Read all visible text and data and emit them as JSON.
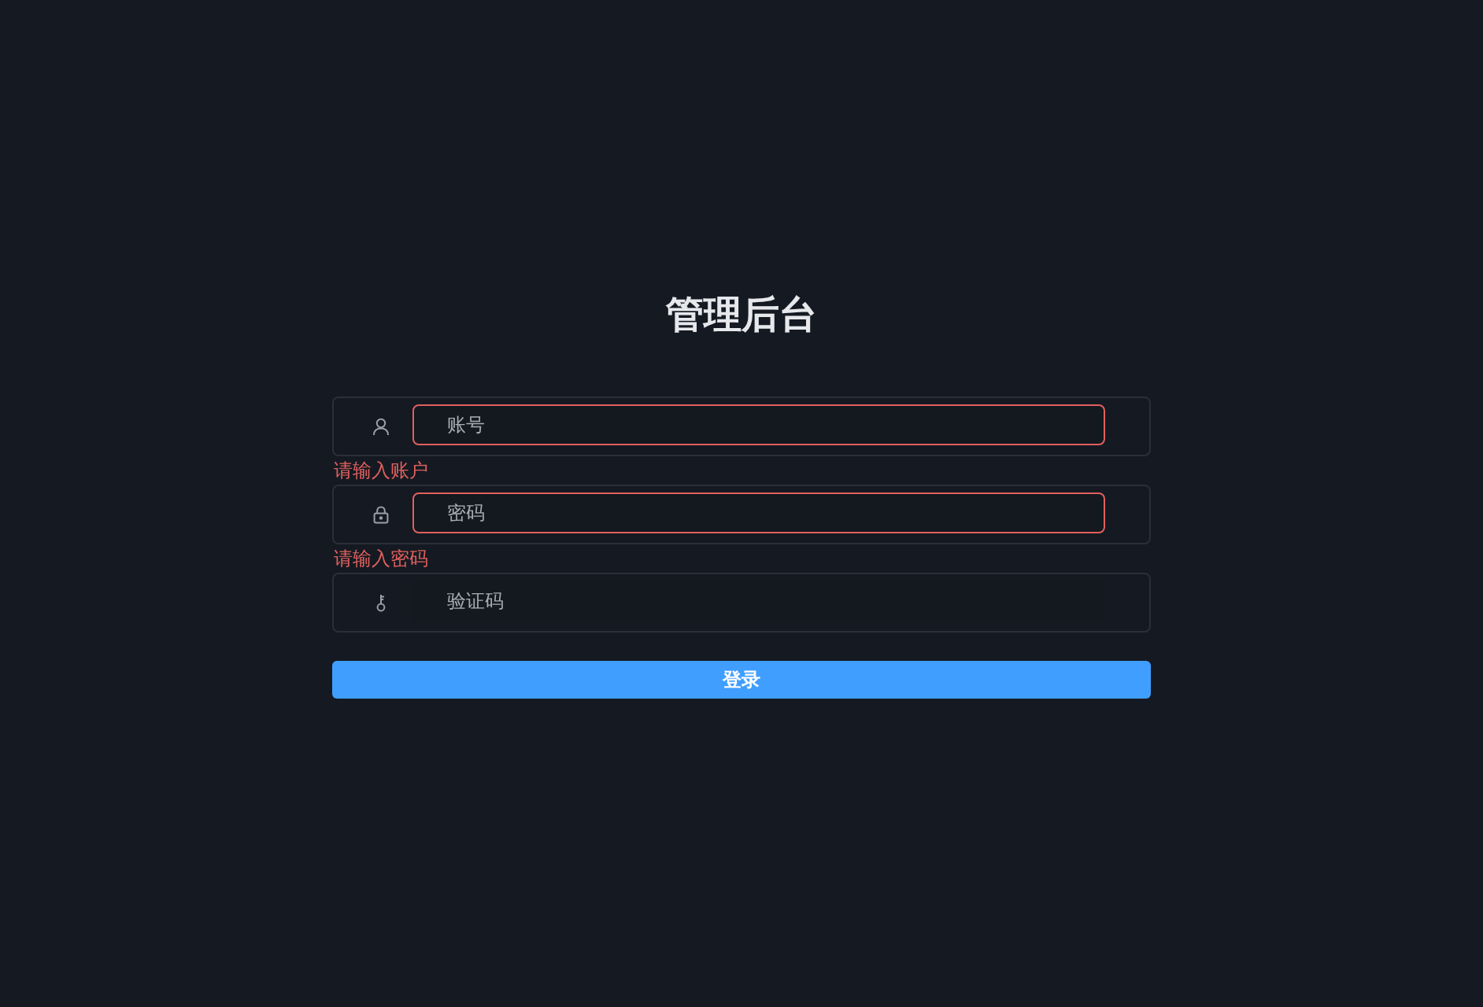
{
  "title": "管理后台",
  "fields": [
    {
      "kind": "user",
      "placeholder": "账号",
      "invalid": true,
      "error": "请输入账户"
    },
    {
      "kind": "lock",
      "placeholder": "密码",
      "invalid": true,
      "error": "请输入密码"
    },
    {
      "kind": "key",
      "placeholder": "验证码",
      "invalid": false
    }
  ],
  "submit": "登录"
}
